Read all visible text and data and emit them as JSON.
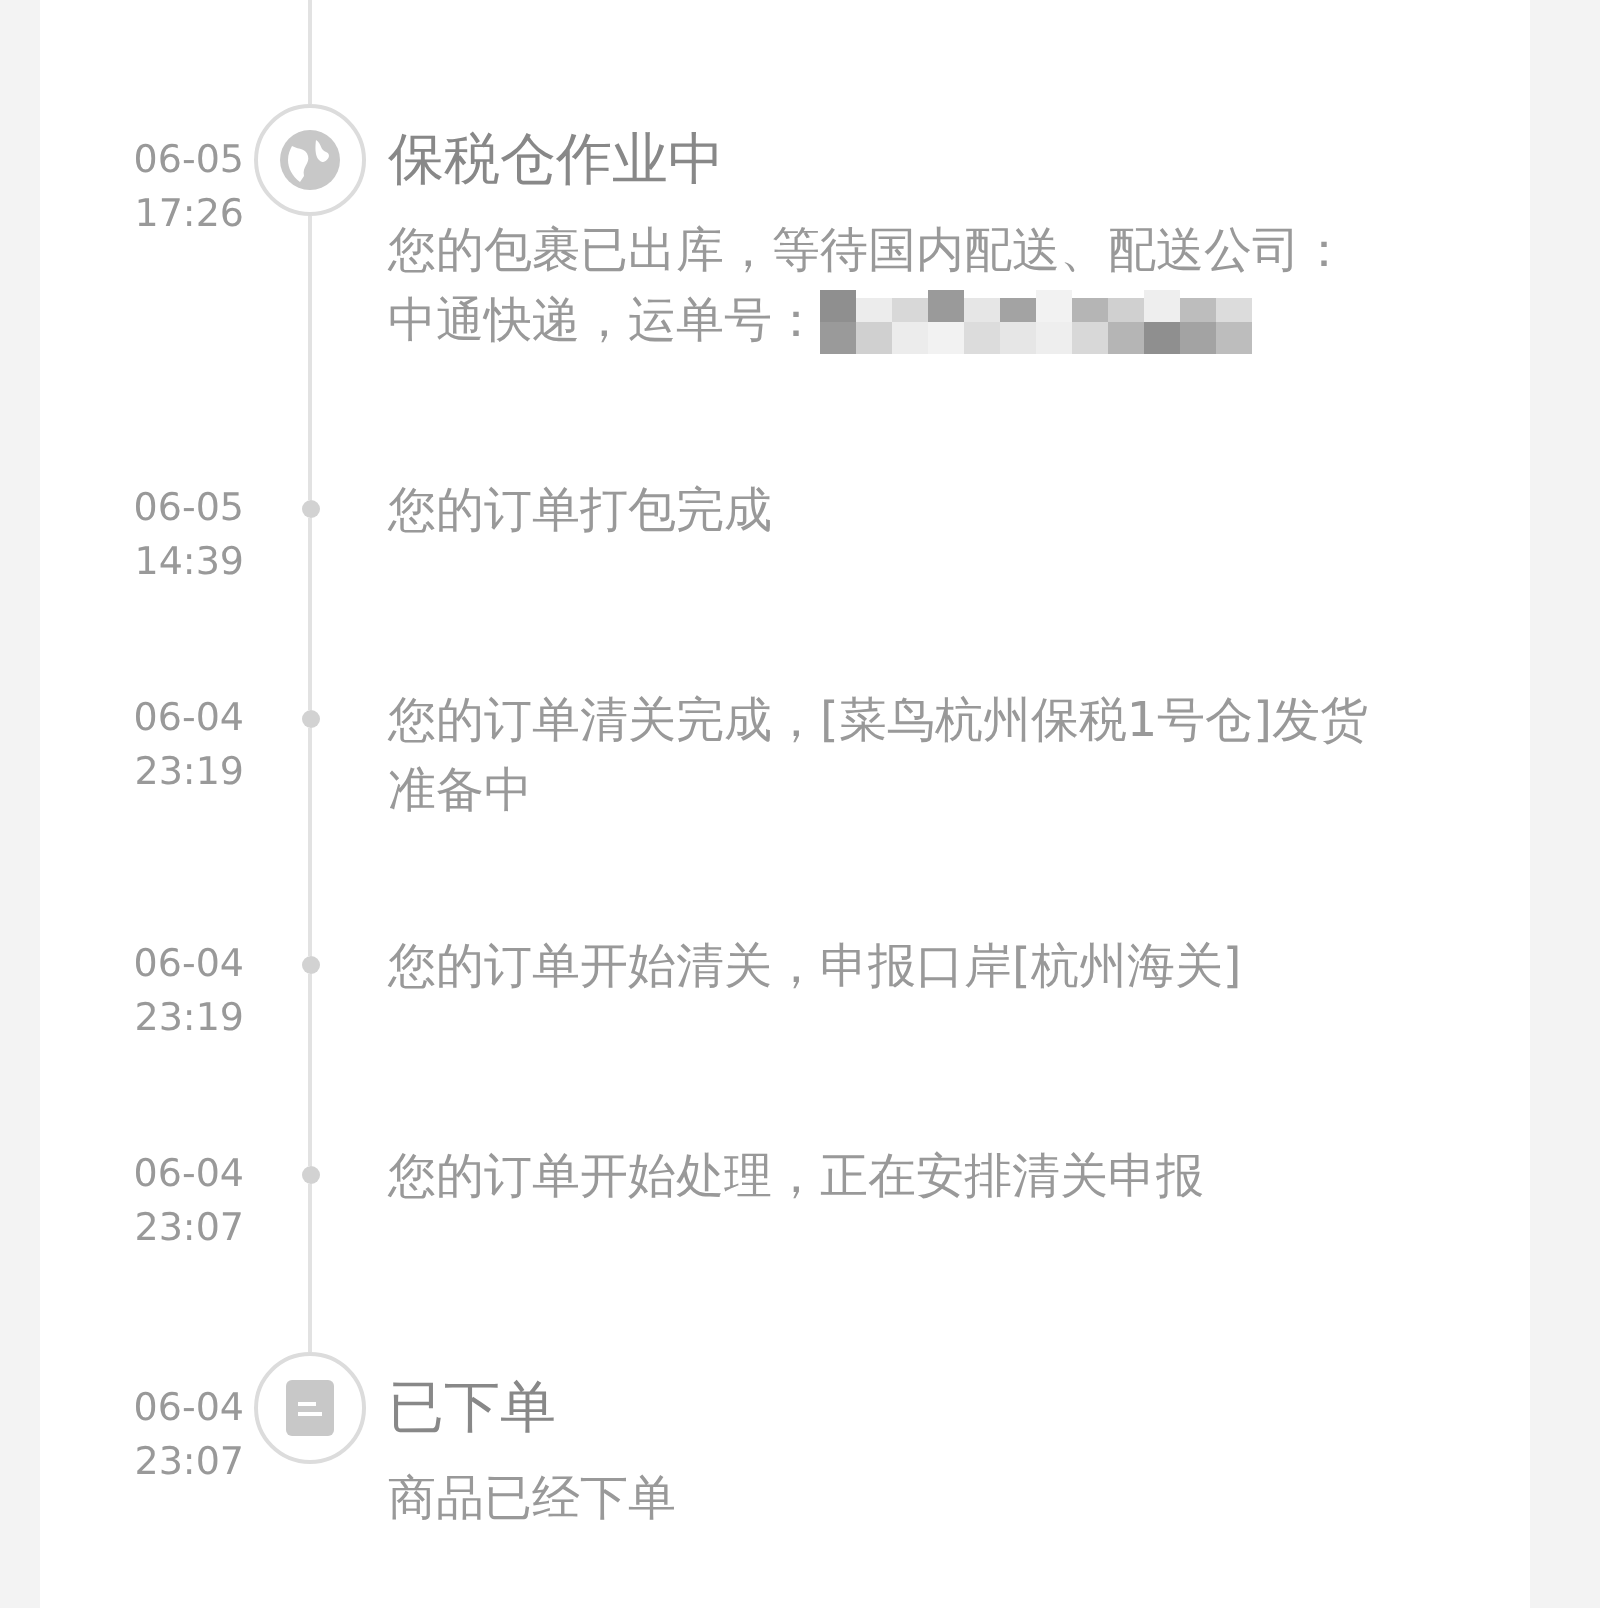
{
  "events": [
    {
      "kind": "warehouse",
      "date": "06-05",
      "time": "17:26",
      "title": "保税仓作业中",
      "description": "您的包裹已出库，等待国内配送、配送公司：中通快递，运单号：",
      "tracking_number_masked": true
    },
    {
      "kind": "step",
      "date": "06-05",
      "time": "14:39",
      "description": "您的订单打包完成"
    },
    {
      "kind": "step",
      "date": "06-04",
      "time": "23:19",
      "description": "您的订单清关完成，[菜鸟杭州保税1号仓]发货准备中"
    },
    {
      "kind": "step",
      "date": "06-04",
      "time": "23:19",
      "description": "您的订单开始清关，申报口岸[杭州海关]"
    },
    {
      "kind": "step",
      "date": "06-04",
      "time": "23:07",
      "description": "您的订单开始处理，正在安排清关申报"
    },
    {
      "kind": "ordered",
      "date": "06-04",
      "time": "23:07",
      "title": "已下单",
      "description": "商品已经下单"
    }
  ]
}
